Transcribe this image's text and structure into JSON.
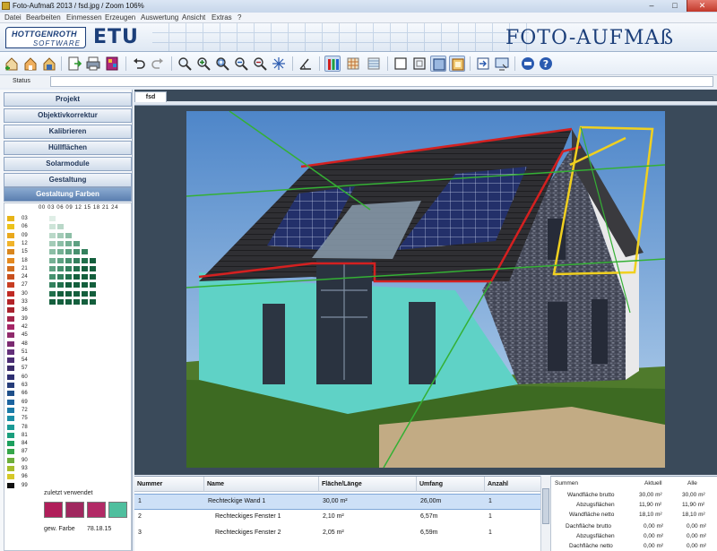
{
  "window": {
    "title": "Foto-Aufmaß 2013 / fsd.jpg / Zoom 106%"
  },
  "menu": [
    "Datei",
    "Bearbeiten",
    "Einmessen",
    "Erzeugen",
    "Auswertung",
    "Ansicht",
    "Extras",
    "?"
  ],
  "banner": {
    "logo_line1": "HOTTGENROTH",
    "logo_line2": "SOFTWARE",
    "mark": "ETU",
    "product": "FOTO-AUFMAß"
  },
  "status": {
    "label": "Status",
    "value": ""
  },
  "sidebar": {
    "items": [
      "Projekt",
      "Objektivkorrektur",
      "Kalibrieren",
      "Hüllflächen",
      "Solarmodule",
      "Gestaltung",
      "Gestaltung Farben"
    ],
    "active_index": 6
  },
  "palette": {
    "col_header": "00 03 06 09 12 15 18 21 24",
    "row_labels": [
      "03",
      "06",
      "09",
      "12",
      "15",
      "18",
      "21",
      "24",
      "27",
      "30",
      "33",
      "36",
      "39",
      "42",
      "45",
      "48",
      "51",
      "54",
      "57",
      "60",
      "63",
      "66",
      "69",
      "72",
      "75",
      "78",
      "81",
      "84",
      "87",
      "90",
      "93",
      "96",
      "99"
    ],
    "row_colors": [
      "#e7b417",
      "#ecc21b",
      "#e9a81c",
      "#f0b32a",
      "#d9861d",
      "#e4891f",
      "#d26d1e",
      "#c84f1d",
      "#c73d22",
      "#bf2a24",
      "#b22328",
      "#a8222d",
      "#a3244a",
      "#a52566",
      "#8f2a6c",
      "#7b2a71",
      "#63307a",
      "#4a2c73",
      "#3a2c6a",
      "#2e2f72",
      "#263d7a",
      "#1e4f8a",
      "#1c64a0",
      "#1b7aa8",
      "#1a8ea6",
      "#1a9a95",
      "#1a9e7d",
      "#1ca05e",
      "#35a64a",
      "#6cae3c",
      "#a6bd2c",
      "#d6c828",
      "#111111"
    ],
    "recent_label": "zuletzt verwendet",
    "recent_colors": [
      "#b01e5a",
      "#a0285f",
      "#b22a66",
      "#4fbf9e"
    ],
    "selected_label": "gew. Farbe",
    "selected_code": "78.18.15"
  },
  "viewer": {
    "tab": "fsd"
  },
  "table": {
    "headers": [
      "Nummer",
      "Name",
      "Fläche/Länge",
      "Umfang",
      "Anzahl"
    ],
    "rows": [
      {
        "nr": "1",
        "name": "Rechteckige Wand 1",
        "area": "30,00 m²",
        "perim": "26,00m",
        "count": "1"
      },
      {
        "nr": "2",
        "name": "Rechteckiges Fenster 1",
        "area": "2,10 m²",
        "perim": "6,57m",
        "count": "1"
      },
      {
        "nr": "3",
        "name": "Rechteckiges Fenster 2",
        "area": "2,05 m²",
        "perim": "6,59m",
        "count": "1"
      }
    ]
  },
  "summary": {
    "header": {
      "label": "Summen",
      "current": "Aktuell",
      "all": "Alle"
    },
    "rows": [
      {
        "label": "Wandfläche brutto",
        "current": "30,00  m²",
        "all": "30,00  m²"
      },
      {
        "label": "Abzugsflächen",
        "current": "11,90  m²",
        "all": "11,90  m²"
      },
      {
        "label": "Wandfläche netto",
        "current": "18,10  m²",
        "all": "18,10  m²"
      },
      {
        "label": "Dachfläche brutto",
        "current": "0,00  m²",
        "all": "0,00  m²"
      },
      {
        "label": "Abzugsflächen",
        "current": "0,00  m²",
        "all": "0,00  m²"
      },
      {
        "label": "Dachfläche netto",
        "current": "0,00  m²",
        "all": "0,00  m²"
      }
    ]
  }
}
